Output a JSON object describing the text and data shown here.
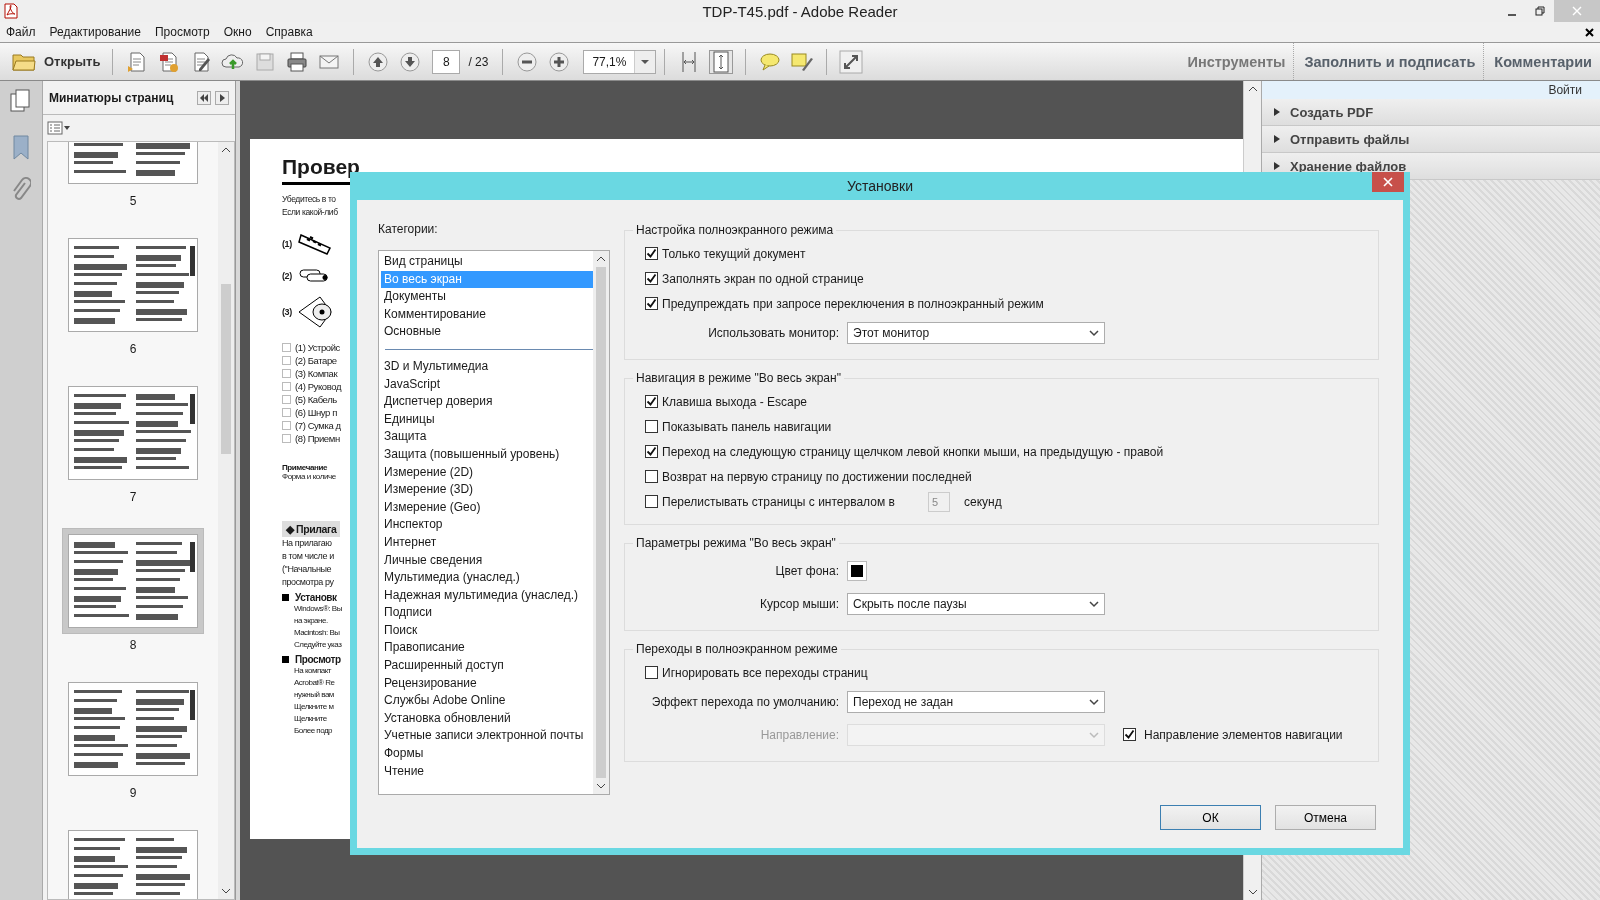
{
  "window": {
    "title": "TDP-T45.pdf - Adobe Reader"
  },
  "menu": [
    "Файл",
    "Редактирование",
    "Просмотр",
    "Окно",
    "Справка"
  ],
  "toolbar": {
    "open_label": "Открыть",
    "page": "8",
    "page_total": "/ 23",
    "zoom": "77,1%",
    "tabs": [
      "Инструменты",
      "Заполнить и подписать",
      "Комментарии"
    ]
  },
  "thumbnails_panel": {
    "title": "Миниатюры страниц",
    "pages": [
      {
        "number": "5",
        "selected": false
      },
      {
        "number": "6",
        "selected": false
      },
      {
        "number": "7",
        "selected": false
      },
      {
        "number": "8",
        "selected": true
      },
      {
        "number": "9",
        "selected": false
      }
    ]
  },
  "document": {
    "heading": "Провер",
    "intro": [
      "Убедитесь в то",
      "Если какой-либ"
    ],
    "figures": [
      "(1)",
      "(2)",
      "(3)"
    ],
    "checklist": [
      "(1) Устройс",
      "(2) Батаре",
      "(3) Компак",
      "(4) Руковод",
      "(5) Кабель",
      "(6) Шнур п",
      "(7) Сумка д",
      "(8) Приемн"
    ],
    "note_title": "Примечание",
    "note": "Форма и количе",
    "section": "◆ Прилага",
    "paragraph": [
      "На прилагаю",
      "в том числе и",
      "(\"Начальные",
      "просмотра ру"
    ],
    "subsections": [
      {
        "title": "Установк",
        "lines": [
          "Windows®: Вы",
          "на экране.",
          "Macintosh: Вы",
          "Следуйте указ"
        ]
      },
      {
        "title": "Просмотр",
        "lines": [
          "На компакт",
          "Acrobat® Re",
          "нужный вам",
          "Щелкните м",
          "Щелкните",
          "Более подр"
        ]
      }
    ]
  },
  "right_panel": {
    "sign_in": "Войти",
    "sections": [
      "Создать PDF",
      "Отправить файлы",
      "Хранение файлов"
    ]
  },
  "dialog": {
    "title": "Установки",
    "categories_label": "Категории:",
    "category_groups": [
      [
        {
          "label": "Вид страницы",
          "selected": false
        },
        {
          "label": "Во весь экран",
          "selected": true
        },
        {
          "label": "Документы",
          "selected": false
        },
        {
          "label": "Комментирование",
          "selected": false
        },
        {
          "label": "Основные",
          "selected": false
        }
      ],
      [
        {
          "label": "3D и Мультимедиа",
          "selected": false
        },
        {
          "label": "JavaScript",
          "selected": false
        },
        {
          "label": "Диспетчер доверия",
          "selected": false
        },
        {
          "label": "Единицы",
          "selected": false
        },
        {
          "label": "Защита",
          "selected": false
        },
        {
          "label": "Защита (повышенный уровень)",
          "selected": false
        },
        {
          "label": "Измерение (2D)",
          "selected": false
        },
        {
          "label": "Измерение (3D)",
          "selected": false
        },
        {
          "label": "Измерение (Geo)",
          "selected": false
        },
        {
          "label": "Инспектор",
          "selected": false
        },
        {
          "label": "Интернет",
          "selected": false
        },
        {
          "label": "Личные сведения",
          "selected": false
        },
        {
          "label": "Мультимедиа (унаслед.)",
          "selected": false
        },
        {
          "label": "Надежная мультимедиа (унаслед.)",
          "selected": false
        },
        {
          "label": "Подписи",
          "selected": false
        },
        {
          "label": "Поиск",
          "selected": false
        },
        {
          "label": "Правописание",
          "selected": false
        },
        {
          "label": "Расширенный доступ",
          "selected": false
        },
        {
          "label": "Рецензирование",
          "selected": false
        },
        {
          "label": "Службы Adobe Online",
          "selected": false
        },
        {
          "label": "Установка обновлений",
          "selected": false
        },
        {
          "label": "Учетные записи электронной почты",
          "selected": false
        },
        {
          "label": "Формы",
          "selected": false
        },
        {
          "label": "Чтение",
          "selected": false
        }
      ]
    ],
    "groups": [
      {
        "title": "Настройка полноэкранного режима",
        "rows": [
          {
            "kind": "checkbox",
            "label": "Только текущий документ",
            "checked": true
          },
          {
            "kind": "checkbox",
            "label": "Заполнять экран по одной странице",
            "checked": true
          },
          {
            "kind": "checkbox",
            "label": "Предупреждать при запросе переключения в полноэкранный режим",
            "checked": true
          },
          {
            "kind": "select",
            "label": "Использовать монитор:",
            "value": "Этот монитор"
          }
        ]
      },
      {
        "title": "Навигация в режиме \"Во весь экран\"",
        "rows": [
          {
            "kind": "checkbox",
            "label": "Клавиша выхода - Escape",
            "checked": true
          },
          {
            "kind": "checkbox",
            "label": "Показывать панель навигации",
            "checked": false
          },
          {
            "kind": "checkbox",
            "label": "Переход на следующую страницу щелчком левой кнопки мыши, на предыдущую - правой",
            "checked": true
          },
          {
            "kind": "checkbox",
            "label": "Возврат на первую страницу по достижении последней",
            "checked": false
          },
          {
            "kind": "interval",
            "label": "Перелистывать страницы с интервалом в",
            "checked": false,
            "value": "5",
            "disabled": true,
            "unit": "секунд"
          }
        ]
      },
      {
        "title": "Параметры режима \"Во весь экран\"",
        "rows": [
          {
            "kind": "color",
            "label": "Цвет фона:",
            "color": "#000000"
          },
          {
            "kind": "select",
            "label": "Курсор мыши:",
            "value": "Скрыть после паузы"
          }
        ]
      },
      {
        "title": "Переходы в полноэкранном режиме",
        "rows": [
          {
            "kind": "checkbox",
            "label": "Игнорировать все переходы страниц",
            "checked": false
          },
          {
            "kind": "select",
            "label": "Эффект перехода по умолчанию:",
            "value": "Переход не задан"
          },
          {
            "kind": "select_checkbox",
            "label": "Направление:",
            "disabled": true,
            "check_label": "Направление элементов навигации",
            "checked": true
          }
        ]
      }
    ],
    "buttons": [
      {
        "label": "ОК",
        "focused": true
      },
      {
        "label": "Отмена",
        "focused": false
      }
    ]
  }
}
